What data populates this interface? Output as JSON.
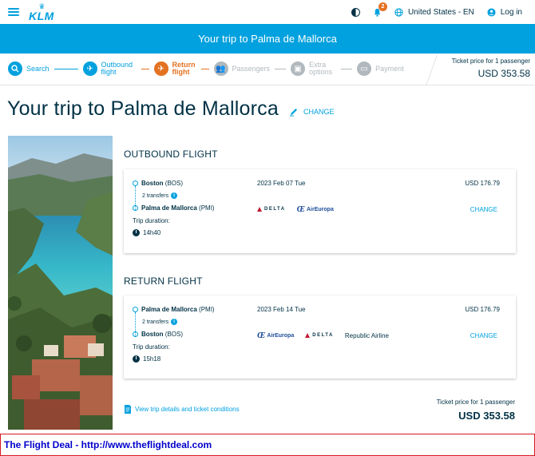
{
  "nav": {
    "logo": "KLM",
    "notifications_count": "2",
    "locale": "United States - EN",
    "login": "Log in"
  },
  "banner": {
    "title": "Your trip to Palma de Mallorca"
  },
  "stepper": {
    "steps": [
      {
        "label": "Search",
        "state": "done"
      },
      {
        "label": "Outbound flight",
        "state": "done"
      },
      {
        "label": "Return flight",
        "state": "active"
      },
      {
        "label": "Passengers",
        "state": "todo"
      },
      {
        "label": "Extra options",
        "state": "todo"
      },
      {
        "label": "Payment",
        "state": "todo"
      }
    ],
    "price_caption": "Ticket price for 1 passenger",
    "price": "USD 353.58"
  },
  "page": {
    "title": "Your trip to Palma de Mallorca",
    "change": "CHANGE"
  },
  "outbound": {
    "section_title": "OUTBOUND FLIGHT",
    "from_city": "Boston",
    "from_code": "(BOS)",
    "transfers": "2 transfers",
    "to_city": "Palma de Mallorca",
    "to_code": "(PMI)",
    "duration_caption": "Trip duration:",
    "duration": "14h40",
    "date": "2023 Feb 07 Tue",
    "price": "USD 176.79",
    "change": "CHANGE",
    "carriers": [
      "DELTA",
      "AirEuropa"
    ]
  },
  "return": {
    "section_title": "RETURN FLIGHT",
    "from_city": "Palma de Mallorca",
    "from_code": "(PMI)",
    "transfers": "2 transfers",
    "to_city": "Boston",
    "to_code": "(BOS)",
    "duration_caption": "Trip duration:",
    "duration": "15h18",
    "date": "2023 Feb 14 Tue",
    "price": "USD 176.79",
    "change": "CHANGE",
    "carriers": [
      "AirEuropa",
      "DELTA"
    ],
    "extra_carrier": "Republic Airline"
  },
  "summary": {
    "view_details": "View trip details and ticket conditions",
    "price_caption": "Ticket price for 1 passenger",
    "price": "USD 353.58"
  },
  "footer": {
    "text": "The Flight Deal - http://www.theflightdeal.com"
  },
  "colors": {
    "brand_blue": "#00a1de",
    "active_orange": "#e37222",
    "text_navy": "#003145",
    "inactive_gray": "#b1b9be",
    "footer_border": "#d71920"
  }
}
